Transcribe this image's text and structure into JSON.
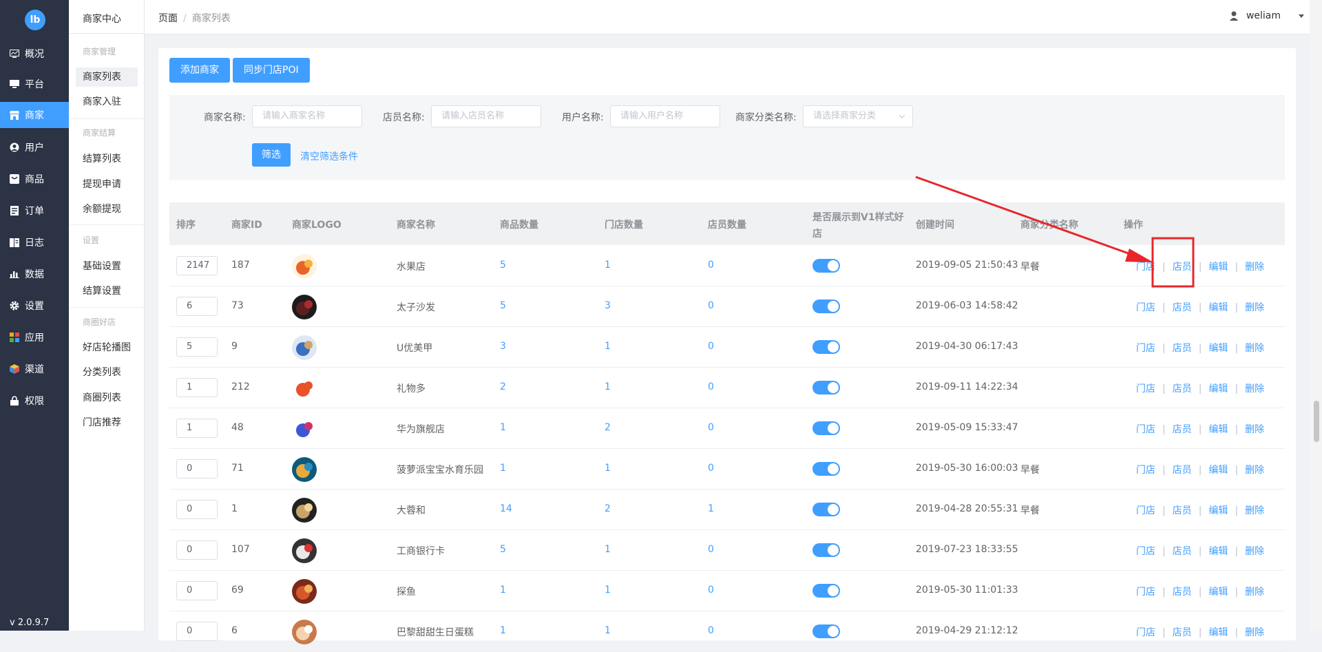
{
  "sidebar": {
    "logo": "lb",
    "items": [
      {
        "label": "概况",
        "icon": "dashboard-icon"
      },
      {
        "label": "平台",
        "icon": "monitor-icon"
      },
      {
        "label": "商家",
        "icon": "store-icon",
        "active": true
      },
      {
        "label": "用户",
        "icon": "user-icon"
      },
      {
        "label": "商品",
        "icon": "goods-icon"
      },
      {
        "label": "订单",
        "icon": "order-icon"
      },
      {
        "label": "日志",
        "icon": "log-icon"
      },
      {
        "label": "数据",
        "icon": "chart-icon"
      },
      {
        "label": "设置",
        "icon": "gear-icon"
      },
      {
        "label": "应用",
        "icon": "apps-icon"
      },
      {
        "label": "渠道",
        "icon": "cube-icon"
      },
      {
        "label": "权限",
        "icon": "lock-icon"
      }
    ],
    "version": "v 2.0.9.7"
  },
  "submenu": {
    "title": "商家中心",
    "groups": [
      {
        "title": "商家管理",
        "items": [
          "商家列表",
          "商家入驻"
        ]
      },
      {
        "title": "商家结算",
        "items": [
          "结算列表",
          "提现申请",
          "余额提现"
        ]
      },
      {
        "title": "设置",
        "items": [
          "基础设置",
          "结算设置"
        ]
      },
      {
        "title": "商圈好店",
        "items": [
          "好店轮播图",
          "分类列表",
          "商圈列表",
          "门店推荐"
        ]
      }
    ]
  },
  "header": {
    "breadcrumb": [
      "页面",
      "商家列表"
    ],
    "username": "weliam"
  },
  "toolbar": {
    "add_label": "添加商家",
    "sync_label": "同步门店POI"
  },
  "filter": {
    "merchant_name_label": "商家名称:",
    "merchant_name_placeholder": "请输入商家名称",
    "store_name_label": "店员名称:",
    "store_name_placeholder": "请输入店员名称",
    "user_name_label": "用户名称:",
    "user_name_placeholder": "请输入用户名称",
    "category_label": "商家分类名称:",
    "category_placeholder": "请选择商家分类",
    "submit_label": "筛选",
    "clear_label": "清空筛选条件"
  },
  "table": {
    "columns": [
      "排序",
      "商家ID",
      "商家LOGO",
      "商家名称",
      "商品数量",
      "门店数量",
      "店员数量",
      "是否展示到V1样式好",
      "店",
      "创建时间",
      "商家分类名称",
      "操作"
    ],
    "op_labels": [
      "门店",
      "店员",
      "编辑",
      "删除"
    ],
    "rows": [
      {
        "sort": "2147",
        "id": "187",
        "name": "水果店",
        "goods": "5",
        "stores": "1",
        "staff": "0",
        "created": "2019-09-05 21:50:43",
        "category": "早餐"
      },
      {
        "sort": "6",
        "id": "73",
        "name": "太子沙发",
        "goods": "5",
        "stores": "3",
        "staff": "0",
        "created": "2019-06-03 14:58:42",
        "category": ""
      },
      {
        "sort": "5",
        "id": "9",
        "name": "U优美甲",
        "goods": "3",
        "stores": "1",
        "staff": "0",
        "created": "2019-04-30 06:17:43",
        "category": ""
      },
      {
        "sort": "1",
        "id": "212",
        "name": "礼物多",
        "goods": "2",
        "stores": "1",
        "staff": "0",
        "created": "2019-09-11 14:22:34",
        "category": ""
      },
      {
        "sort": "1",
        "id": "48",
        "name": "华为旗舰店",
        "goods": "1",
        "stores": "2",
        "staff": "0",
        "created": "2019-05-09 15:33:47",
        "category": ""
      },
      {
        "sort": "0",
        "id": "71",
        "name": "菠萝派宝宝水育乐园",
        "goods": "1",
        "stores": "1",
        "staff": "0",
        "created": "2019-05-30 16:00:03",
        "category": "早餐"
      },
      {
        "sort": "0",
        "id": "1",
        "name": "大蓉和",
        "goods": "14",
        "stores": "2",
        "staff": "1",
        "created": "2019-04-28 20:55:31",
        "category": "早餐"
      },
      {
        "sort": "0",
        "id": "107",
        "name": "工商银行卡",
        "goods": "5",
        "stores": "1",
        "staff": "0",
        "created": "2019-07-23 18:33:55",
        "category": ""
      },
      {
        "sort": "0",
        "id": "69",
        "name": "探鱼",
        "goods": "1",
        "stores": "1",
        "staff": "0",
        "created": "2019-05-30 11:01:33",
        "category": ""
      },
      {
        "sort": "0",
        "id": "6",
        "name": "巴黎甜甜生日蛋糕",
        "goods": "1",
        "stores": "1",
        "staff": "0",
        "created": "2019-04-29 21:12:12",
        "category": ""
      }
    ]
  },
  "colors": {
    "accent": "#409eff",
    "sidebar": "#2b3345",
    "annotation": "#e8262a"
  }
}
